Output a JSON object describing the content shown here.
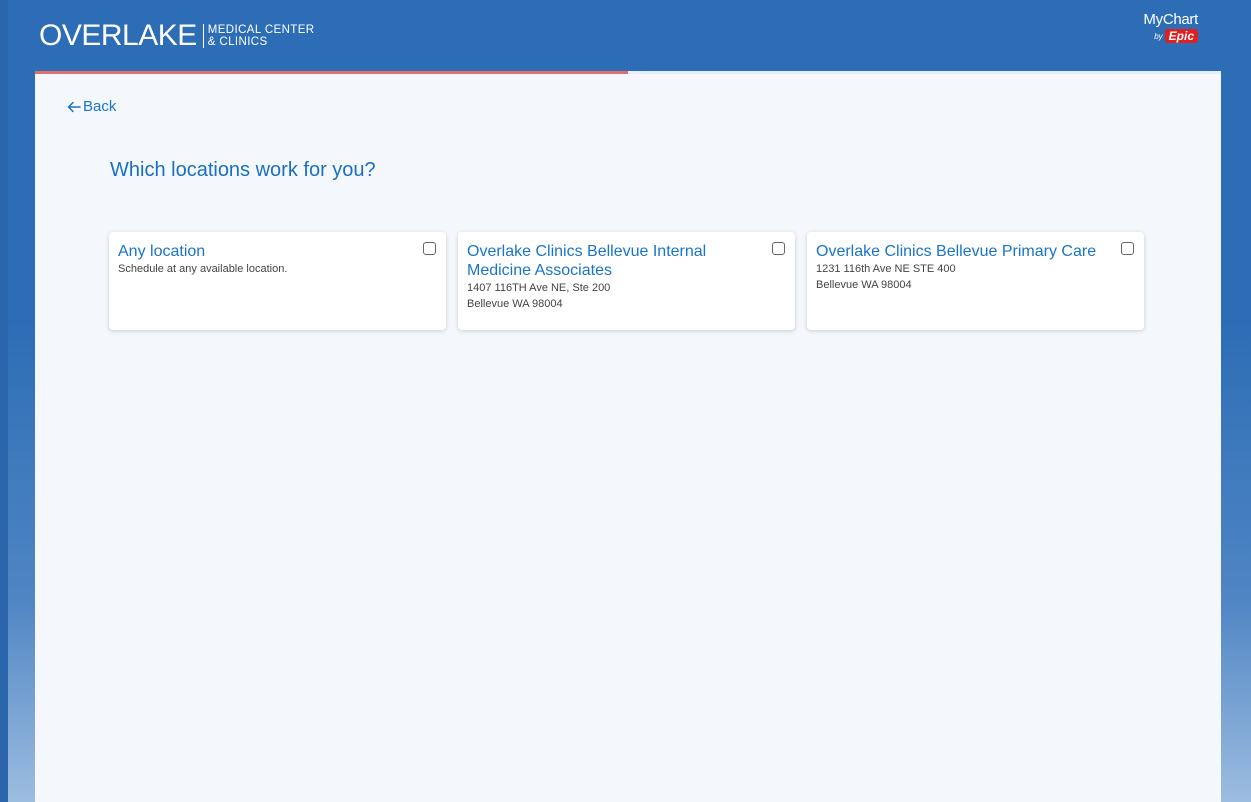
{
  "header": {
    "brand_name": "OVERLAKE",
    "brand_line1": "MEDICAL CENTER",
    "brand_line2": "& CLINICS",
    "mychart_label": "MyChart",
    "by_label": "by",
    "epic_label": "Epic"
  },
  "progress": {
    "fraction": 0.5
  },
  "nav": {
    "back_label": "Back",
    "back_icon": "left-arrow-icon"
  },
  "question": "Which locations work for you?",
  "locations": [
    {
      "title": "Any location",
      "line1": "Schedule at any available location.",
      "line2": "",
      "checked": false
    },
    {
      "title": "Overlake Clinics Bellevue Internal Medicine Associates",
      "line1": "1407 116TH Ave NE, Ste 200",
      "line2": "Bellevue WA 98004",
      "checked": false
    },
    {
      "title": "Overlake Clinics Bellevue Primary Care",
      "line1": "1231 116th Ave NE STE 400",
      "line2": "Bellevue WA 98004",
      "checked": false
    }
  ],
  "colors": {
    "header_bg": "#2d6db5",
    "link_blue": "#1a75c7",
    "progress_accent": "#e2706a"
  }
}
